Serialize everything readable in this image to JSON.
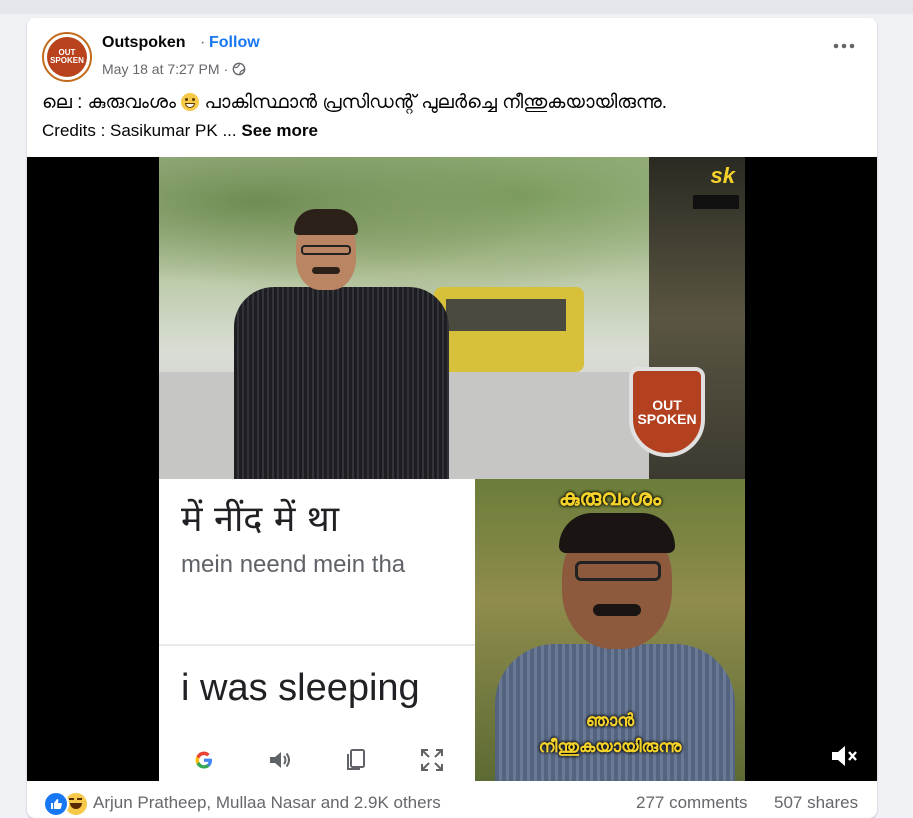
{
  "post": {
    "page_name": "Outspoken",
    "separator": "·",
    "follow_label": "Follow",
    "timestamp": "May 18 at 7:27 PM",
    "timestamp_separator": "·",
    "privacy_icon": "globe-icon",
    "more_icon": "more-dots-icon",
    "caption_before_emoji": "ലെ : കുരുവംശം",
    "caption_emoji": "grinning-face-emoji",
    "caption_after_emoji": "പാകിസ്ഥാൻ പ്രസിഡന്റ് പുലർച്ചെ നീന്തുകയായിരുന്നു.",
    "credits": "Credits : Sasikumar PK ...",
    "see_more": "See more",
    "avatar": {
      "line1": "OUT",
      "line2": "SPOKEN"
    }
  },
  "video": {
    "watermark": "sk",
    "badge": {
      "line1": "OUT",
      "line2": "SPOKEN"
    },
    "translate": {
      "hindi_text": "में नींद में था",
      "transliteration": "mein neend mein tha",
      "english_text": "i was sleeping",
      "icons": [
        "google-icon",
        "speaker-icon",
        "copy-icon",
        "expand-icon"
      ]
    },
    "portrait": {
      "title": "കുരുവംശം",
      "caption_line1": "ഞാൻ",
      "caption_line2": "നീന്തുകയായിരുന്നു"
    },
    "mute_icon": "muted-speaker-icon"
  },
  "footer": {
    "reactions": [
      "like-icon",
      "haha-icon"
    ],
    "reactors_text": "Arjun Pratheep, Mullaa Nasar and 2.9K others",
    "comments": "277 comments",
    "shares": "507 shares"
  },
  "colors": {
    "link_blue": "#1877f2",
    "secondary_text": "#65676b",
    "caption_yellow": "#f5d32b",
    "brand_orange": "#b3401f"
  }
}
